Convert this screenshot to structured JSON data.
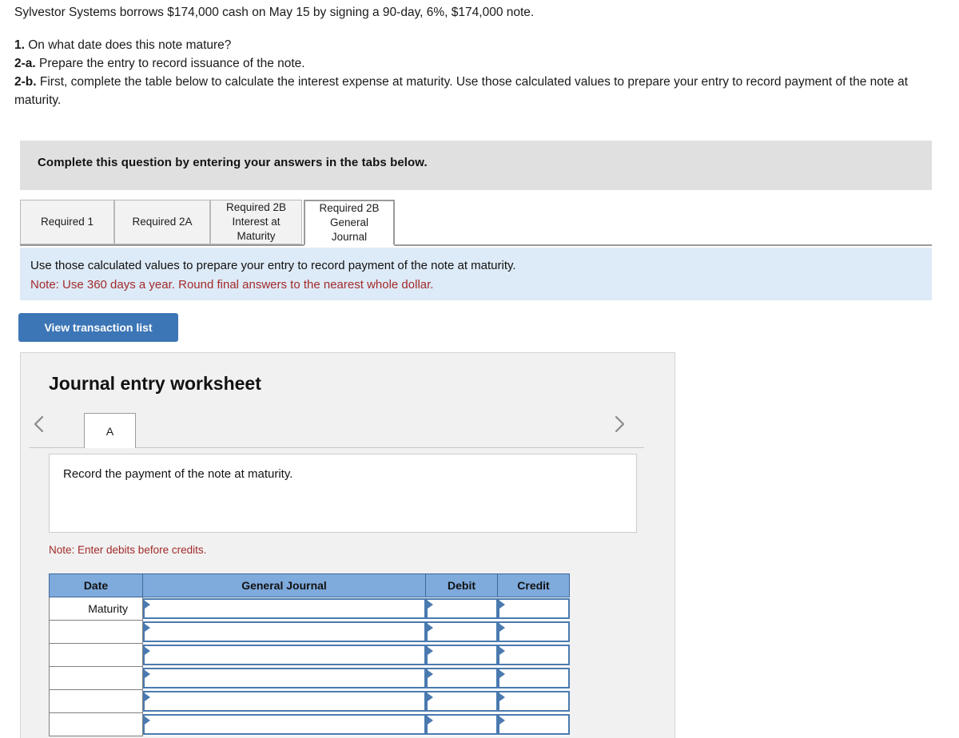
{
  "problem": {
    "lead": "Sylvestor Systems borrows $174,000 cash on May 15 by signing a 90-day, 6%, $174,000 note.",
    "requirements": [
      {
        "num": "1.",
        "text": " On what date does this note mature?"
      },
      {
        "num": "2-a.",
        "text": " Prepare the entry to record issuance of the note."
      },
      {
        "num": "2-b.",
        "text": " First, complete the table below to calculate the interest expense at maturity. Use those calculated values to prepare your entry to record payment of the note at maturity."
      }
    ]
  },
  "banner": {
    "text": "Complete this question by entering your answers in the tabs below."
  },
  "tabs": [
    {
      "label": "Required 1",
      "active": false
    },
    {
      "label": "Required 2A",
      "active": false
    },
    {
      "label": "Required 2B\nInterest at\nMaturity",
      "active": false
    },
    {
      "label": "Required 2B\nGeneral\nJournal",
      "active": true
    }
  ],
  "info": {
    "line1": "Use those calculated values to prepare your entry to record payment of the note at maturity.",
    "line2": "Note: Use 360 days a year. Round final answers to the nearest whole dollar.",
    "background": "#ddeaf7",
    "note_color": "#a32b2b"
  },
  "view_button": {
    "label": "View transaction list",
    "color": "#3c76b6"
  },
  "worksheet": {
    "title": "Journal entry worksheet",
    "prev_icon": "chevron-left-icon",
    "next_icon": "chevron-right-icon",
    "entry_tabs": [
      {
        "label": "A",
        "active": true
      }
    ],
    "description": "Record the payment of the note at maturity.",
    "note": "Note: Enter debits before credits.",
    "table": {
      "headers": [
        "Date",
        "General Journal",
        "Debit",
        "Credit"
      ],
      "header_color": "#7eaadc",
      "cell_border_color": "#4a7ab0",
      "rows": [
        {
          "date": "Maturity",
          "general_journal": "",
          "debit": "",
          "credit": ""
        },
        {
          "date": "",
          "general_journal": "",
          "debit": "",
          "credit": ""
        },
        {
          "date": "",
          "general_journal": "",
          "debit": "",
          "credit": ""
        },
        {
          "date": "",
          "general_journal": "",
          "debit": "",
          "credit": ""
        },
        {
          "date": "",
          "general_journal": "",
          "debit": "",
          "credit": ""
        },
        {
          "date": "",
          "general_journal": "",
          "debit": "",
          "credit": ""
        }
      ]
    }
  }
}
